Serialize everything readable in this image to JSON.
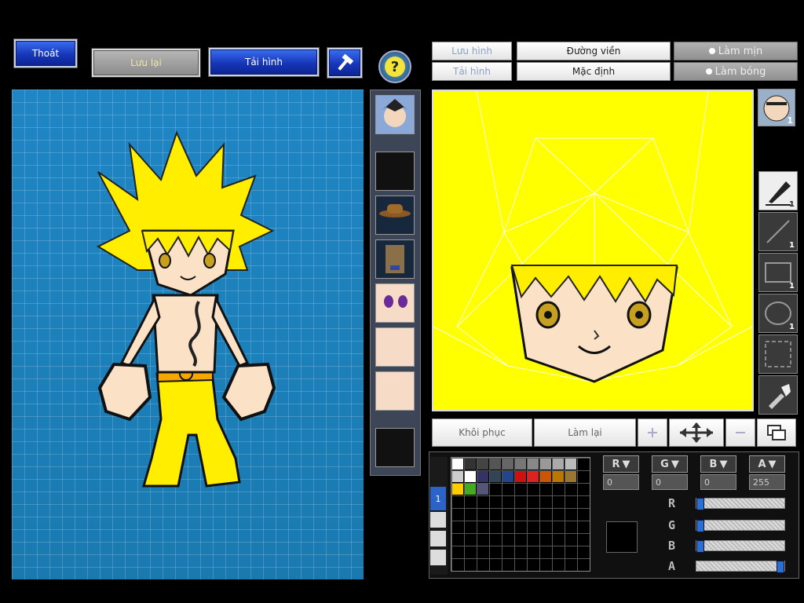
{
  "toolbar": {
    "exit_label": "Thoát",
    "save_label": "Lưu lại",
    "reload_label": "Tải hình",
    "tool_icon": "hammer-icon",
    "help_icon": "question-icon"
  },
  "editor_toolbar": {
    "save_label": "Lưu hình",
    "load_label": "Tải hình",
    "outline_label": "Đường viền",
    "default_label": "Mặc định",
    "smooth_label": "Làm mịn",
    "shade_label": "Làm bóng"
  },
  "editor_actions": {
    "restore_label": "Khôi phục",
    "redo_label": "Làm lại"
  },
  "layer_badge": "1",
  "tools": [
    {
      "icon": "pen-icon",
      "count": "1"
    },
    {
      "icon": "line-icon",
      "count": "1"
    },
    {
      "icon": "rectangle-icon",
      "count": "1"
    },
    {
      "icon": "ellipse-icon",
      "count": "1"
    },
    {
      "icon": "select-icon",
      "count": ""
    },
    {
      "icon": "eyedropper-icon",
      "count": ""
    }
  ],
  "palette": {
    "page_label": "1",
    "colors": [
      "#ffffff",
      "#333333",
      "#444444",
      "#555555",
      "#666666",
      "#777777",
      "#888888",
      "#999999",
      "#aaaaaa",
      "#bbbbbb",
      "#cccccc",
      "#ffffff",
      "#333366",
      "#334455",
      "#224488",
      "#cc1111",
      "#dd2222",
      "#cc5500",
      "#bb7700",
      "#997733",
      "#ffcc00",
      "#44aa22",
      "#555577"
    ]
  },
  "channels": {
    "r": {
      "label": "R",
      "value": "0"
    },
    "g": {
      "label": "G",
      "value": "0"
    },
    "b": {
      "label": "B",
      "value": "0"
    },
    "a": {
      "label": "A",
      "value": "255"
    }
  },
  "sliders": {
    "r": 0,
    "g": 0,
    "b": 0,
    "a": 255
  },
  "colors": {
    "editor_bg": "#ffff00",
    "canvas_bg": "#1e82bc",
    "hair": "#ffee00",
    "skin": "#fbe2c6"
  }
}
